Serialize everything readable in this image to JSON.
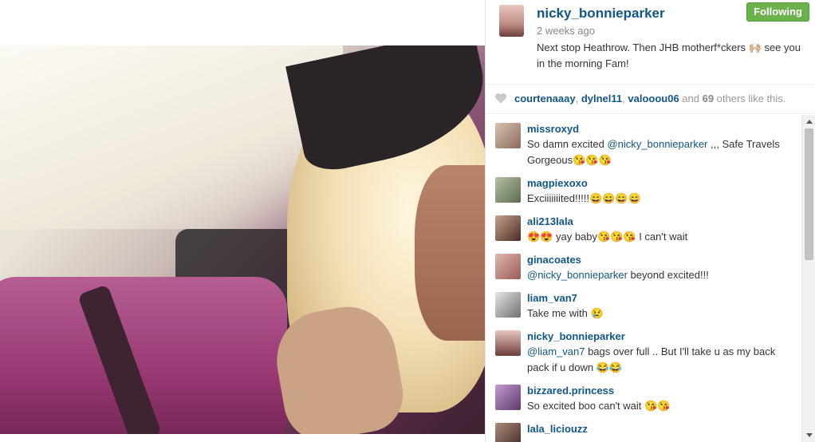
{
  "post": {
    "username": "nicky_bonnieparker",
    "follow_label": "Following",
    "time": "2 weeks ago",
    "caption": "Next stop Heathrow. Then JHB motherf*ckers 🙌🏼 see you in the morning Fam!"
  },
  "likes": {
    "likers": [
      "courtenaaay",
      "dylnel11",
      "valooou06"
    ],
    "sep1": ", ",
    "sep2": ", ",
    "and_text": " and ",
    "count": "69",
    "suffix": " others like this."
  },
  "comments": [
    {
      "user": "missroxyd",
      "pre": "So damn excited ",
      "mention": "@nicky_bonnieparker",
      "post": " ,,, Safe Travels Gorgeous😘😘😘"
    },
    {
      "user": "magpiexoxo",
      "pre": "Exciiiiiiited!!!!!😄😄😄😄",
      "mention": "",
      "post": ""
    },
    {
      "user": "ali213lala",
      "pre": "😍😍 yay baby😘😘😘 I can't wait",
      "mention": "",
      "post": ""
    },
    {
      "user": "ginacoates",
      "pre": "",
      "mention": "@nicky_bonnieparker",
      "post": " beyond excited!!!"
    },
    {
      "user": "liam_van7",
      "pre": "Take me with 😢",
      "mention": "",
      "post": ""
    },
    {
      "user": "nicky_bonnieparker",
      "pre": "",
      "mention": "@liam_van7",
      "post": " bags over full .. But I'll take u as my back pack if u down 😂😂"
    },
    {
      "user": "bizzared.princess",
      "pre": "So excited boo can't wait 😘😘",
      "mention": "",
      "post": ""
    },
    {
      "user": "lala_liciouzz",
      "pre": "",
      "mention": "",
      "post": ""
    }
  ],
  "colors": {
    "link": "#125688",
    "follow_bg": "#6bb24d"
  },
  "icons": {
    "like": "heart-icon"
  }
}
